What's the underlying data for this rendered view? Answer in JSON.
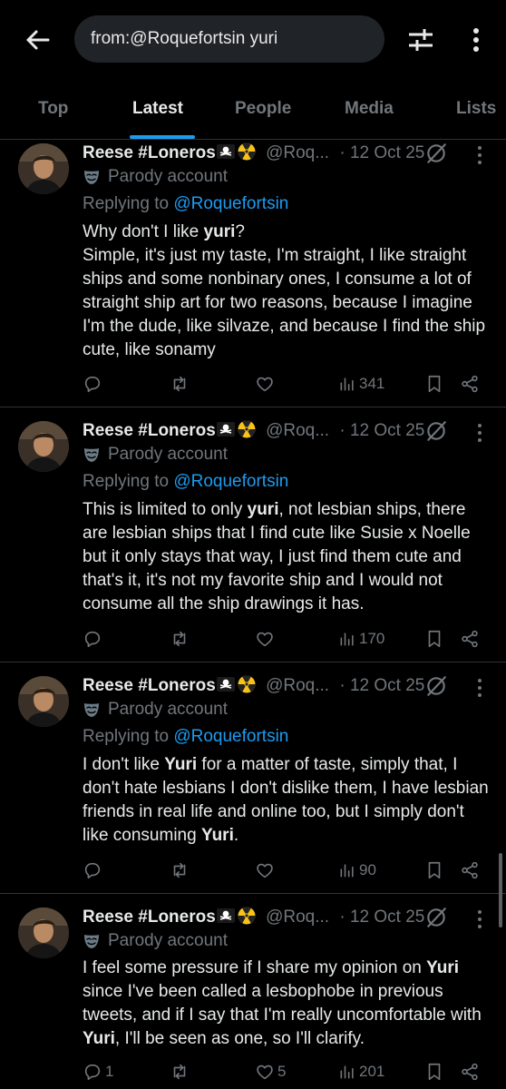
{
  "search": {
    "query": "from:@Roquefortsin yuri"
  },
  "tabs": [
    {
      "label": "Top"
    },
    {
      "label": "Latest"
    },
    {
      "label": "People"
    },
    {
      "label": "Media"
    },
    {
      "label": "Lists"
    }
  ],
  "colors": {
    "accent": "#1d9bf0",
    "secondary_text": "#71767b",
    "separator": "#2f3336"
  },
  "tweets": [
    {
      "name": "Reese #Loneros",
      "handle": "@Roq...",
      "date": "· 12 Oct 25",
      "parody_label": "Parody account",
      "reply_prefix": "Replying to",
      "reply_to": "@Roquefortsin",
      "body_1": "Why don't I like ",
      "body_bold_1": "yuri",
      "body_2": "?",
      "body_3": "Simple, it's just my taste, I'm straight, I like straight ships and some nonbinary ones, I consume a lot of straight ship art for two reasons, because I imagine I'm the dude, like silvaze, and because I find the ship cute, like sonamy",
      "replies": "",
      "likes": "",
      "views": "341"
    },
    {
      "name": "Reese #Loneros",
      "handle": "@Roq...",
      "date": "· 12 Oct 25",
      "parody_label": "Parody account",
      "reply_prefix": "Replying to",
      "reply_to": "@Roquefortsin",
      "body_1": "This is limited to only ",
      "body_bold_1": "yuri",
      "body_2": ", not lesbian ships, there are lesbian ships that I find cute like Susie x Noelle but it only stays that way, I just find them cute and that's it, it's not my favorite ship and I would not consume all the ship drawings it has.",
      "replies": "",
      "likes": "",
      "views": "170"
    },
    {
      "name": "Reese #Loneros",
      "handle": "@Roq...",
      "date": "· 12 Oct 25",
      "parody_label": "Parody account",
      "reply_prefix": "Replying to",
      "reply_to": "@Roquefortsin",
      "body_1": "I don't like ",
      "body_bold_1": "Yuri",
      "body_2": " for a matter of taste, simply that, I don't hate lesbians I don't dislike them, I have lesbian friends in real life and online too, but I simply don't like consuming ",
      "body_bold_2": "Yuri",
      "body_3": ".",
      "replies": "",
      "likes": "",
      "views": "90"
    },
    {
      "name": "Reese #Loneros",
      "handle": "@Roq...",
      "date": "· 12 Oct 25",
      "parody_label": "Parody account",
      "body_1": "I feel some pressure if I share my opinion on ",
      "body_bold_1": "Yuri",
      "body_2": " since I've been called a lesbophobe in previous tweets, and if I say that I'm really uncomfortable with ",
      "body_bold_2": "Yuri",
      "body_3": ", I'll be seen as one, so I'll clarify.",
      "replies": "1",
      "likes": "5",
      "views": "201"
    }
  ]
}
